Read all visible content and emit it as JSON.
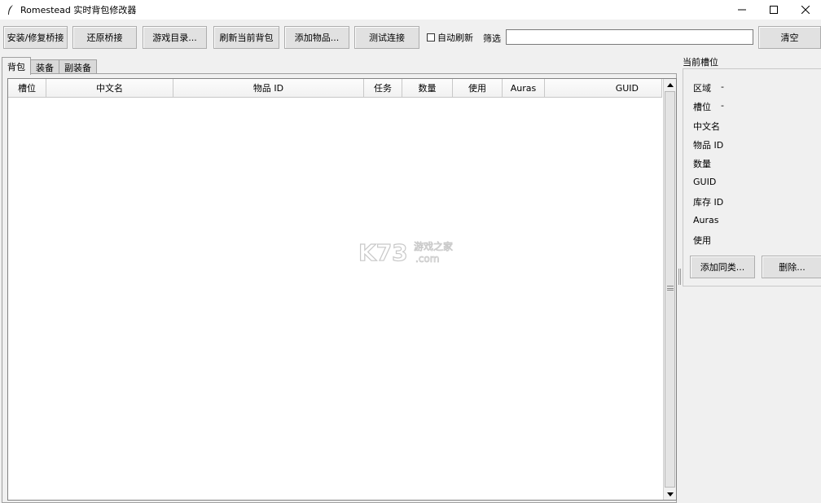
{
  "window": {
    "title": "Romestead 实时背包修改器"
  },
  "toolbar": {
    "install_bridge": "安装/修复桥接",
    "restore_bridge": "还原桥接",
    "game_dir": "游戏目录...",
    "refresh_bag": "刷新当前背包",
    "add_item": "添加物品...",
    "test_connection": "测试连接",
    "auto_refresh": "自动刷新",
    "filter_label": "筛选",
    "filter_value": "",
    "clear": "清空"
  },
  "tabs": [
    {
      "label": "背包",
      "active": true
    },
    {
      "label": "装备",
      "active": false
    },
    {
      "label": "副装备",
      "active": false
    }
  ],
  "table": {
    "columns": [
      "槽位",
      "中文名",
      "物品 ID",
      "任务",
      "数量",
      "使用",
      "Auras",
      "GUID"
    ],
    "rows": []
  },
  "detail": {
    "title": "当前槽位",
    "fields": [
      {
        "label": "区域",
        "value": "-"
      },
      {
        "label": "槽位",
        "value": "-"
      },
      {
        "label": "中文名",
        "value": ""
      },
      {
        "label": "物品 ID",
        "value": ""
      },
      {
        "label": "数量",
        "value": ""
      },
      {
        "label": "GUID",
        "value": ""
      },
      {
        "label": "库存 ID",
        "value": ""
      },
      {
        "label": "Auras",
        "value": ""
      },
      {
        "label": "使用",
        "value": ""
      }
    ],
    "add_similar": "添加同类...",
    "delete": "删除..."
  },
  "watermark": {
    "brand": "K73",
    "sub": "游戏之家",
    "domain": ".com"
  }
}
